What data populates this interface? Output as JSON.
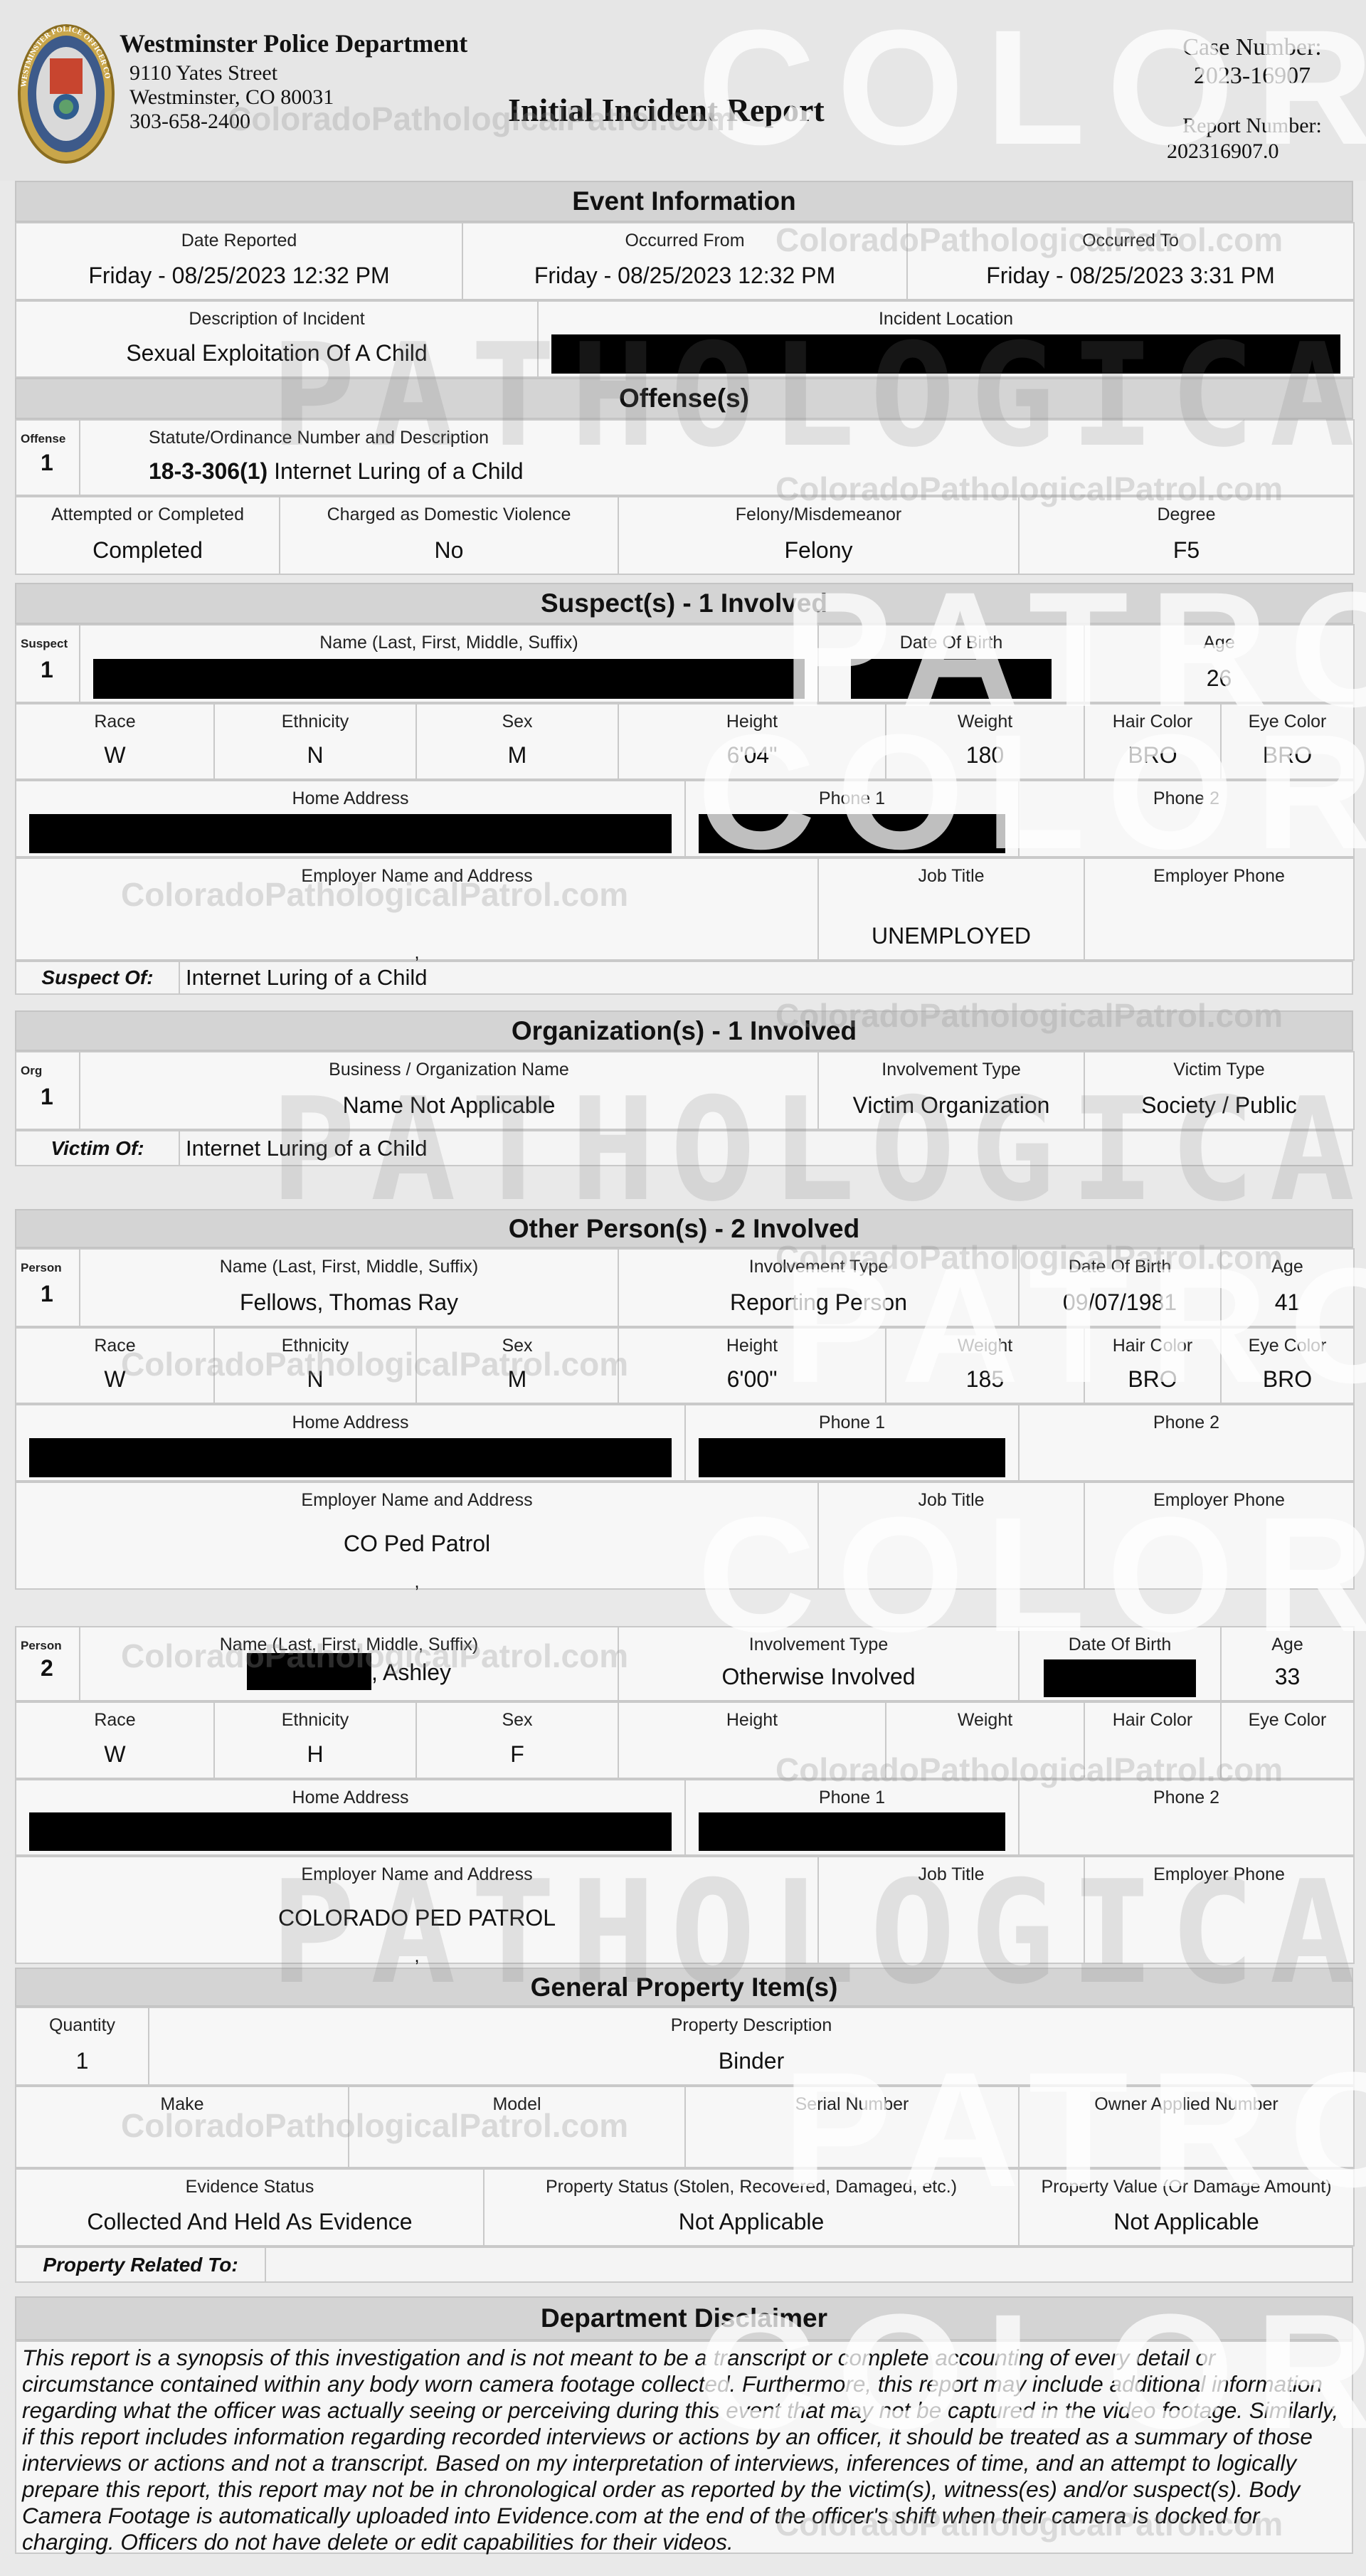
{
  "header": {
    "dept_name": "Westminster Police Department",
    "address_line1": "9110 Yates Street",
    "address_line2": "Westminster, CO 80031",
    "phone": "303-658-2400",
    "report_title": "Initial Incident Report",
    "case_number_label": "Case Number:",
    "case_number": "2023-16907",
    "report_number_label": "Report Number:",
    "report_number": "202316907.0",
    "badge_text": "WESTMINSTER POLICE OFFICER CO"
  },
  "event": {
    "title": "Event Information",
    "rows": [
      [
        {
          "label": "Date Reported",
          "value": "Friday - 08/25/2023  12:32 PM"
        },
        {
          "label": "Occurred From",
          "value": "Friday - 08/25/2023  12:32 PM"
        },
        {
          "label": "Occurred To",
          "value": "Friday - 08/25/2023  3:31 PM"
        }
      ],
      [
        {
          "label": "Description of Incident",
          "value": "Sexual Exploitation Of A Child"
        },
        {
          "label": "Incident Location",
          "redacted": true
        }
      ]
    ]
  },
  "offenses": {
    "title": "Offense(s)",
    "rows": [
      [
        {
          "label": "Offense",
          "value": "1"
        },
        {
          "label": "Statute/Ordinance Number and Description",
          "value_bold": "18-3-306(1)",
          "value": " Internet Luring of a Child"
        }
      ],
      [
        {
          "label": "Attempted or Completed",
          "value": "Completed"
        },
        {
          "label": "Charged as Domestic Violence",
          "value": "No"
        },
        {
          "label": "Felony/Misdemeanor",
          "value": "Felony"
        },
        {
          "label": "Degree",
          "value": "F5"
        }
      ]
    ]
  },
  "suspects": {
    "title": "Suspect(s) - 1 Involved",
    "rows": [
      [
        {
          "label": "Suspect",
          "value": "1"
        },
        {
          "label": "Name (Last, First, Middle, Suffix)",
          "redacted": true
        },
        {
          "label": "Date Of Birth",
          "redacted": true
        },
        {
          "label": "Age",
          "value": "26"
        }
      ],
      [
        {
          "label": "Race",
          "value": "W"
        },
        {
          "label": "Ethnicity",
          "value": "N"
        },
        {
          "label": "Sex",
          "value": "M"
        },
        {
          "label": "Height",
          "value": "6'04\""
        },
        {
          "label": "Weight",
          "value": "180"
        },
        {
          "label": "Hair Color",
          "value": "BRO"
        },
        {
          "label": "Eye Color",
          "value": "BRO"
        }
      ],
      [
        {
          "label": "Home Address",
          "redacted": true
        },
        {
          "label": "Phone 1",
          "redacted": true
        },
        {
          "label": "Phone 2",
          "value": ""
        }
      ],
      [
        {
          "label": "Employer Name and Address",
          "value": "",
          "value2": ","
        },
        {
          "label": "Job Title",
          "value": "UNEMPLOYED"
        },
        {
          "label": "Employer Phone",
          "value": ""
        }
      ]
    ],
    "related": {
      "label": "Suspect Of:",
      "value": "Internet Luring of a Child"
    }
  },
  "orgs": {
    "title": "Organization(s) - 1 Involved",
    "rows": [
      [
        {
          "label": "Org",
          "value": "1"
        },
        {
          "label": "Business / Organization Name",
          "value": "Name Not Applicable"
        },
        {
          "label": "Involvement Type",
          "value": "Victim Organization"
        },
        {
          "label": "Victim Type",
          "value": "Society / Public"
        }
      ]
    ],
    "related": {
      "label": "Victim Of:",
      "value": "Internet Luring of a Child"
    }
  },
  "others": {
    "title": "Other Person(s) - 2 Involved",
    "rows": [
      [
        {
          "label": "Person",
          "value": "1"
        },
        {
          "label": "Name (Last, First, Middle, Suffix)",
          "value": "Fellows, Thomas Ray"
        },
        {
          "label": "Involvement Type",
          "value": "Reporting Person"
        },
        {
          "label": "Date Of Birth",
          "value": "09/07/1981"
        },
        {
          "label": "Age",
          "value": "41"
        }
      ],
      [
        {
          "label": "Race",
          "value": "W"
        },
        {
          "label": "Ethnicity",
          "value": "N"
        },
        {
          "label": "Sex",
          "value": "M"
        },
        {
          "label": "Height",
          "value": "6'00\""
        },
        {
          "label": "Weight",
          "value": "185"
        },
        {
          "label": "Hair Color",
          "value": "BRO"
        },
        {
          "label": "Eye Color",
          "value": "BRO"
        }
      ],
      [
        {
          "label": "Home Address",
          "redacted": true
        },
        {
          "label": "Phone 1",
          "redacted": true
        },
        {
          "label": "Phone 2",
          "value": ""
        }
      ],
      [
        {
          "label": "Employer Name and Address",
          "value": "CO Ped Patrol",
          "value2": ","
        },
        {
          "label": "Job Title",
          "value": ""
        },
        {
          "label": "Employer Phone",
          "value": ""
        }
      ],
      [
        {
          "label": "Person",
          "value": "2"
        },
        {
          "label": "Name (Last, First, Middle, Suffix)",
          "value": ", Ashley",
          "redact_prefix": true
        },
        {
          "label": "Involvement Type",
          "value": "Otherwise Involved"
        },
        {
          "label": "Date Of Birth",
          "redacted": true
        },
        {
          "label": "Age",
          "value": "33"
        }
      ],
      [
        {
          "label": "Race",
          "value": "W"
        },
        {
          "label": "Ethnicity",
          "value": "H"
        },
        {
          "label": "Sex",
          "value": "F"
        },
        {
          "label": "Height",
          "value": ""
        },
        {
          "label": "Weight",
          "value": ""
        },
        {
          "label": "Hair Color",
          "value": ""
        },
        {
          "label": "Eye Color",
          "value": ""
        }
      ],
      [
        {
          "label": "Home Address",
          "redacted": true
        },
        {
          "label": "Phone 1",
          "redacted": true
        },
        {
          "label": "Phone 2",
          "value": ""
        }
      ],
      [
        {
          "label": "Employer Name and Address",
          "value": "COLORADO PED PATROL",
          "value2": ","
        },
        {
          "label": "Job Title",
          "value": ""
        },
        {
          "label": "Employer Phone",
          "value": ""
        }
      ]
    ]
  },
  "property": {
    "title": "General Property Item(s)",
    "rows": [
      [
        {
          "label": "Quantity",
          "value": "1"
        },
        {
          "label": "Property Description",
          "value": "Binder"
        }
      ],
      [
        {
          "label": "Make",
          "value": ""
        },
        {
          "label": "Model",
          "value": ""
        },
        {
          "label": "Serial Number",
          "value": ""
        },
        {
          "label": "Owner Applied Number",
          "value": ""
        }
      ],
      [
        {
          "label": "Evidence Status",
          "value": "Collected And Held As Evidence"
        },
        {
          "label": "Property Status (Stolen, Recovered, Damaged, etc.)",
          "value": "Not Applicable"
        },
        {
          "label": "Property Value (Or Damage Amount)",
          "value": "Not Applicable"
        }
      ]
    ],
    "related": {
      "label": "Property Related To:",
      "value": ""
    }
  },
  "disclaimer": {
    "title": "Department Disclaimer",
    "text": "This report is a synopsis of this investigation and is not meant to be a transcript or complete accounting of every detail or circumstance contained within any body worn camera footage collected.  Furthermore, this report may include additional information regarding what the officer was actually seeing or perceiving during this event that may not be captured in the video footage. Similarly, if this report includes information regarding recorded interviews or actions by an officer, it should be treated as a summary of those interviews or actions and not a transcript.  Based on my interpretation of interviews, inferences of time, and an attempt to logically prepare this report, this report may not be in chronological order as reported by the victim(s), witness(es) and/or suspect(s).  Body Camera Footage is automatically uploaded into Evidence.com at the end of the officer's shift when their camera is docked for charging.  Officers do not have delete or edit capabilities for their videos."
  },
  "watermarks": {
    "colorado": "COLORADO",
    "pathological": "PATHOLOGICAL",
    "patrol": "PATROL",
    "url": "ColoradoPathologicalPatrol.com"
  },
  "colors": {
    "page_bg": "#e9e9e9",
    "section_bar": "#d4d4d4",
    "cell_border": "#c9c9c9",
    "redaction": "#000000"
  }
}
